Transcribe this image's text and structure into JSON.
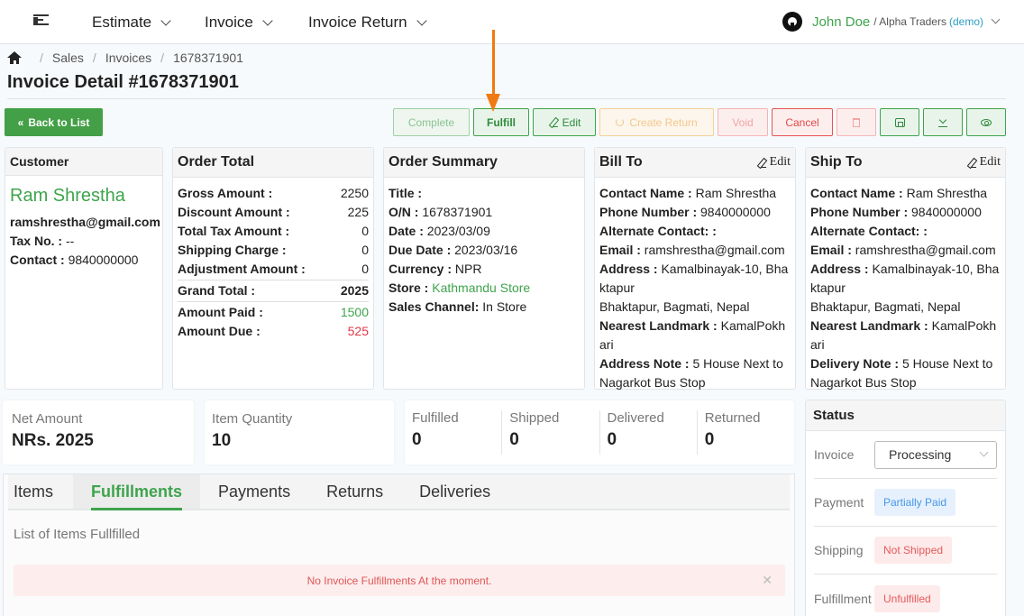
{
  "nav": {
    "items": [
      {
        "label": "Estimate"
      },
      {
        "label": "Invoice"
      },
      {
        "label": "Invoice Return"
      }
    ],
    "user": {
      "name": "John Doe",
      "org": "/ Alpha Traders",
      "tag": "(demo)"
    }
  },
  "breadcrumb": {
    "items": [
      "Sales",
      "Invoices",
      "1678371901"
    ]
  },
  "page": {
    "title": "Invoice Detail #1678371901"
  },
  "toolbar": {
    "back_label": "Back to List",
    "complete_label": "Complete",
    "fulfill_label": "Fulfill",
    "edit_label": "Edit",
    "create_return_label": "Create Return",
    "void_label": "Void",
    "cancel_label": "Cancel"
  },
  "customer": {
    "heading": "Customer",
    "name": "Ram Shrestha",
    "email": "ramshrestha@gmail.com",
    "tax_label": "Tax No. :",
    "tax_value": "--",
    "contact_label": "Contact :",
    "contact_value": "9840000000"
  },
  "order_total": {
    "heading": "Order Total",
    "rows": [
      {
        "label": "Gross Amount :",
        "value": "2250"
      },
      {
        "label": "Discount Amount :",
        "value": "225"
      },
      {
        "label": "Total Tax Amount :",
        "value": "0"
      },
      {
        "label": "Shipping Charge :",
        "value": "0"
      },
      {
        "label": "Adjustment Amount :",
        "value": "0"
      },
      {
        "label": "Grand Total :",
        "value": "2025"
      },
      {
        "label": "Amount Paid :",
        "value": "1500"
      },
      {
        "label": "Amount Due :",
        "value": "525"
      }
    ]
  },
  "order_summary": {
    "heading": "Order Summary",
    "title_label": "Title :",
    "title_value": "",
    "on_label": "O/N :",
    "on_value": "1678371901",
    "date_label": "Date :",
    "date_value": "2023/03/09",
    "due_label": "Due Date :",
    "due_value": "2023/03/16",
    "currency_label": "Currency :",
    "currency_value": "NPR",
    "store_label": "Store :",
    "store_value": "Kathmandu Store",
    "channel_label": "Sales Channel:",
    "channel_value": "In Store"
  },
  "bill_to": {
    "heading": "Bill To",
    "edit_label": "Edit",
    "contact_name_label": "Contact Name :",
    "contact_name": "Ram Shrestha",
    "phone_label": "Phone Number :",
    "phone": "9840000000",
    "alt_label": "Alternate Contact: :",
    "email_label": "Email :",
    "email": "ramshrestha@gmail.com",
    "address_label": "Address :",
    "address": "Kamalbinayak-10, Bhaktapur",
    "region": "Bhaktapur, Bagmati, Nepal",
    "landmark_label": "Nearest Landmark :",
    "landmark": "KamalPokhari",
    "note_label": "Address Note :",
    "note": "5 House Next to Nagarkot Bus Stop"
  },
  "ship_to": {
    "heading": "Ship To",
    "edit_label": "Edit",
    "contact_name_label": "Contact Name :",
    "contact_name": "Ram Shrestha",
    "phone_label": "Phone Number :",
    "phone": "9840000000",
    "alt_label": "Alternate Contact: :",
    "email_label": "Email :",
    "email": "ramshrestha@gmail.com",
    "address_label": "Address :",
    "address": "Kamalbinayak-10, Bhaktapur",
    "region": "Bhaktapur, Bagmati, Nepal",
    "landmark_label": "Nearest Landmark :",
    "landmark": "KamalPokhari",
    "note_label": "Delivery Note :",
    "note": "5 House Next to Nagarkot Bus Stop"
  },
  "stats": {
    "net_label": "Net Amount",
    "net_value": "NRs. 2025",
    "qty_label": "Item Quantity",
    "qty_value": "10",
    "counts": [
      {
        "label": "Fulfilled",
        "value": "0"
      },
      {
        "label": "Shipped",
        "value": "0"
      },
      {
        "label": "Delivered",
        "value": "0"
      },
      {
        "label": "Returned",
        "value": "0"
      }
    ]
  },
  "tabs": {
    "items": [
      {
        "label": "Items"
      },
      {
        "label": "Fulfillments"
      },
      {
        "label": "Payments"
      },
      {
        "label": "Returns"
      },
      {
        "label": "Deliveries"
      }
    ],
    "active": "Fulfillments",
    "description": "List of Items Fullfilled",
    "empty_message": "No Invoice Fulfillments At the moment."
  },
  "status": {
    "heading": "Status",
    "invoice_label": "Invoice",
    "invoice_value": "Processing",
    "payment_label": "Payment",
    "payment_value": "Partially Paid",
    "shipping_label": "Shipping",
    "shipping_value": "Not Shipped",
    "fulfillment_label": "Fulfillment",
    "fulfillment_value": "Unfulfilled"
  },
  "colors": {
    "brand_green": "#43a047",
    "danger_red": "#e04848",
    "warning_orange": "#f2c88d",
    "info_blue": "#4797e6",
    "annotation_arrow": "#f07a12"
  }
}
